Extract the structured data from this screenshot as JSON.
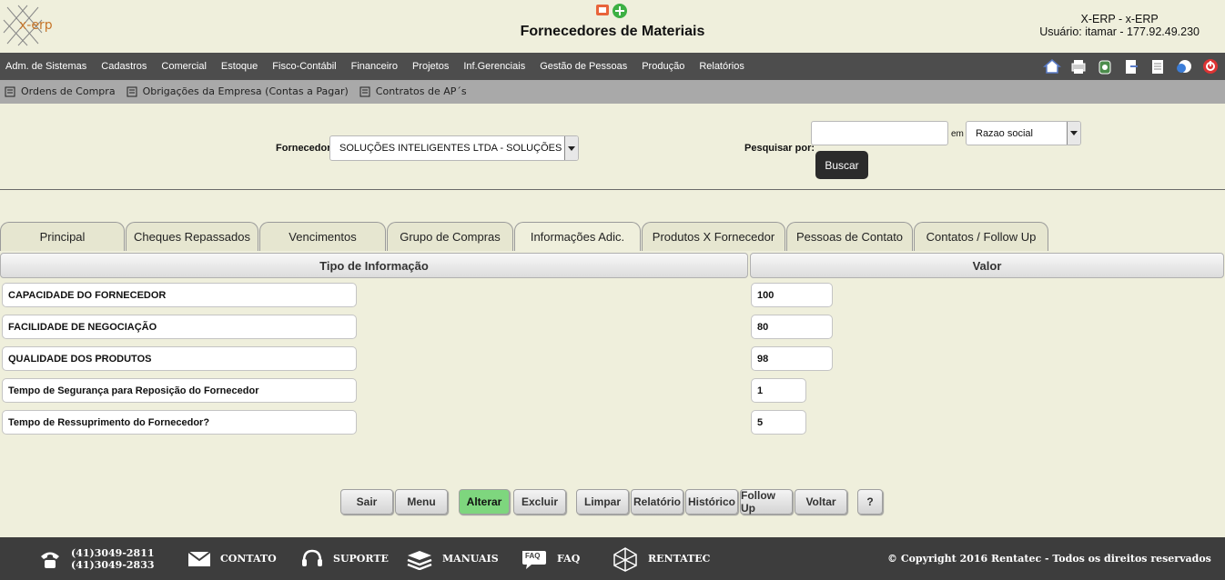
{
  "app": {
    "logo_text": "x-erp",
    "title": "Fornecedores de Materiais",
    "system": "X-ERP - x-ERP",
    "user": "Usuário: itamar - 177.92.49.230"
  },
  "menu": [
    "Adm. de Sistemas",
    "Cadastros",
    "Comercial",
    "Estoque",
    "Fisco-Contábil",
    "Financeiro",
    "Projetos",
    "Inf.Gerenciais",
    "Gestão de Pessoas",
    "Produção",
    "Relatórios"
  ],
  "toolbar_icons": [
    "home-icon",
    "printer-icon",
    "recycle-icon",
    "document-icon",
    "notepad-icon",
    "help-globe-icon",
    "power-icon"
  ],
  "submenu": [
    "Ordens de Compra",
    "Obrigações da Empresa (Contas a Pagar)",
    "Contratos de AP´s"
  ],
  "filter": {
    "supplier_label": "Fornecedor",
    "supplier_value": "SOLUÇÕES INTELIGENTES LTDA - SOLUÇÕES INTEI",
    "search_label": "Pesquisar por:",
    "search_value": "",
    "em_label": "em",
    "search_field": "Razao social",
    "search_button": "Buscar"
  },
  "tabs": [
    "Principal",
    "Cheques Repassados",
    "Vencimentos",
    "Grupo de Compras",
    "Informações Adic.",
    "Produtos X Fornecedor",
    "Pessoas de Contato",
    "Contatos / Follow Up"
  ],
  "active_tab": "Informações Adic.",
  "grid": {
    "col_type": "Tipo de Informação",
    "col_value": "Valor",
    "rows": [
      {
        "name": "CAPACIDADE DO FORNECEDOR",
        "value": "100"
      },
      {
        "name": "FACILIDADE DE NEGOCIAÇÃO",
        "value": "80"
      },
      {
        "name": "QUALIDADE DOS PRODUTOS",
        "value": "98"
      },
      {
        "name": "Tempo de Segurança para Reposição do Fornecedor",
        "value": "1"
      },
      {
        "name": "Tempo de Ressuprimento do Fornecedor?",
        "value": "5"
      }
    ]
  },
  "actions": {
    "sair": "Sair",
    "menu": "Menu",
    "alterar": "Alterar",
    "excluir": "Excluir",
    "limpar": "Limpar",
    "relatorio": "Relatório",
    "historico": "Histórico",
    "followup": "Follow Up",
    "voltar": "Voltar",
    "help": "?"
  },
  "footer": {
    "phone1": "(41)3049-2811",
    "phone2": "(41)3049-2833",
    "contato": "CONTATO",
    "suporte": "SUPORTE",
    "manuais": "MANUAIS",
    "faq": "FAQ",
    "faq_icon_text": "FAQ",
    "rentatec": "RENTATEC",
    "copyright": "© Copyright 2016 Rentatec - Todos os direitos reservados"
  },
  "colors": {
    "menubar": "#4d4d4d",
    "subbar": "#a9a9a9",
    "background": "#efefdc",
    "active_button": "#7ed67e",
    "footer": "#3d3d3d"
  }
}
